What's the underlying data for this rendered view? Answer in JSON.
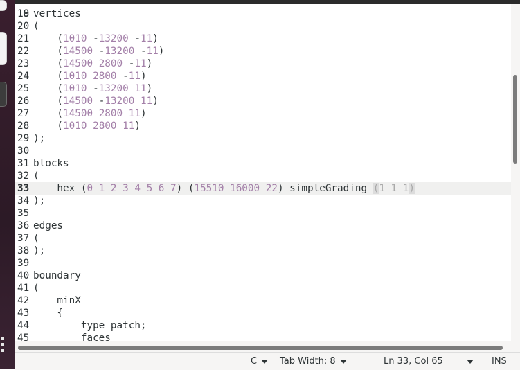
{
  "editor": {
    "current_line": 33,
    "partial_top_line": "18",
    "lines": [
      {
        "n": "19",
        "segs": [
          {
            "t": "vertices",
            "c": ""
          }
        ]
      },
      {
        "n": "20",
        "segs": [
          {
            "t": "(",
            "c": ""
          }
        ]
      },
      {
        "n": "21",
        "segs": [
          {
            "t": "    (",
            "c": ""
          },
          {
            "t": "1010",
            "c": "num"
          },
          {
            "t": " -",
            "c": ""
          },
          {
            "t": "13200",
            "c": "num"
          },
          {
            "t": " -",
            "c": ""
          },
          {
            "t": "11",
            "c": "num"
          },
          {
            "t": ")",
            "c": ""
          }
        ]
      },
      {
        "n": "22",
        "segs": [
          {
            "t": "    (",
            "c": ""
          },
          {
            "t": "14500",
            "c": "num"
          },
          {
            "t": " -",
            "c": ""
          },
          {
            "t": "13200",
            "c": "num"
          },
          {
            "t": " -",
            "c": ""
          },
          {
            "t": "11",
            "c": "num"
          },
          {
            "t": ")",
            "c": ""
          }
        ]
      },
      {
        "n": "23",
        "segs": [
          {
            "t": "    (",
            "c": ""
          },
          {
            "t": "14500",
            "c": "num"
          },
          {
            "t": " ",
            "c": ""
          },
          {
            "t": "2800",
            "c": "num"
          },
          {
            "t": " -",
            "c": ""
          },
          {
            "t": "11",
            "c": "num"
          },
          {
            "t": ")",
            "c": ""
          }
        ]
      },
      {
        "n": "24",
        "segs": [
          {
            "t": "    (",
            "c": ""
          },
          {
            "t": "1010",
            "c": "num"
          },
          {
            "t": " ",
            "c": ""
          },
          {
            "t": "2800",
            "c": "num"
          },
          {
            "t": " -",
            "c": ""
          },
          {
            "t": "11",
            "c": "num"
          },
          {
            "t": ")",
            "c": ""
          }
        ]
      },
      {
        "n": "25",
        "segs": [
          {
            "t": "    (",
            "c": ""
          },
          {
            "t": "1010",
            "c": "num"
          },
          {
            "t": " -",
            "c": ""
          },
          {
            "t": "13200",
            "c": "num"
          },
          {
            "t": " ",
            "c": ""
          },
          {
            "t": "11",
            "c": "num"
          },
          {
            "t": ")",
            "c": ""
          }
        ]
      },
      {
        "n": "26",
        "segs": [
          {
            "t": "    (",
            "c": ""
          },
          {
            "t": "14500",
            "c": "num"
          },
          {
            "t": " -",
            "c": ""
          },
          {
            "t": "13200",
            "c": "num"
          },
          {
            "t": " ",
            "c": ""
          },
          {
            "t": "11",
            "c": "num"
          },
          {
            "t": ")",
            "c": ""
          }
        ]
      },
      {
        "n": "27",
        "segs": [
          {
            "t": "    (",
            "c": ""
          },
          {
            "t": "14500",
            "c": "num"
          },
          {
            "t": " ",
            "c": ""
          },
          {
            "t": "2800",
            "c": "num"
          },
          {
            "t": " ",
            "c": ""
          },
          {
            "t": "11",
            "c": "num"
          },
          {
            "t": ")",
            "c": ""
          }
        ]
      },
      {
        "n": "28",
        "segs": [
          {
            "t": "    (",
            "c": ""
          },
          {
            "t": "1010",
            "c": "num"
          },
          {
            "t": " ",
            "c": ""
          },
          {
            "t": "2800",
            "c": "num"
          },
          {
            "t": " ",
            "c": ""
          },
          {
            "t": "11",
            "c": "num"
          },
          {
            "t": ")",
            "c": ""
          }
        ]
      },
      {
        "n": "29",
        "segs": [
          {
            "t": ");",
            "c": ""
          }
        ]
      },
      {
        "n": "30",
        "segs": []
      },
      {
        "n": "31",
        "segs": [
          {
            "t": "blocks",
            "c": ""
          }
        ]
      },
      {
        "n": "32",
        "segs": [
          {
            "t": "(",
            "c": ""
          }
        ]
      },
      {
        "n": "33",
        "segs": [
          {
            "t": "    hex (",
            "c": ""
          },
          {
            "t": "0",
            "c": "num"
          },
          {
            "t": " ",
            "c": ""
          },
          {
            "t": "1",
            "c": "num"
          },
          {
            "t": " ",
            "c": ""
          },
          {
            "t": "2",
            "c": "num"
          },
          {
            "t": " ",
            "c": ""
          },
          {
            "t": "3",
            "c": "num"
          },
          {
            "t": " ",
            "c": ""
          },
          {
            "t": "4",
            "c": "num"
          },
          {
            "t": " ",
            "c": ""
          },
          {
            "t": "5",
            "c": "num"
          },
          {
            "t": " ",
            "c": ""
          },
          {
            "t": "6",
            "c": "num"
          },
          {
            "t": " ",
            "c": ""
          },
          {
            "t": "7",
            "c": "num"
          },
          {
            "t": ") (",
            "c": ""
          },
          {
            "t": "15510",
            "c": "num"
          },
          {
            "t": " ",
            "c": ""
          },
          {
            "t": "16000",
            "c": "num"
          },
          {
            "t": " ",
            "c": ""
          },
          {
            "t": "22",
            "c": "num"
          },
          {
            "t": ") simpleGrading ",
            "c": ""
          },
          {
            "t": "(",
            "c": "hlp"
          },
          {
            "t": "1 1 1",
            "c": "dim"
          },
          {
            "t": ")",
            "c": "hlp"
          }
        ]
      },
      {
        "n": "34",
        "segs": [
          {
            "t": ");",
            "c": ""
          }
        ]
      },
      {
        "n": "35",
        "segs": []
      },
      {
        "n": "36",
        "segs": [
          {
            "t": "edges",
            "c": ""
          }
        ]
      },
      {
        "n": "37",
        "segs": [
          {
            "t": "(",
            "c": ""
          }
        ]
      },
      {
        "n": "38",
        "segs": [
          {
            "t": ");",
            "c": ""
          }
        ]
      },
      {
        "n": "39",
        "segs": []
      },
      {
        "n": "40",
        "segs": [
          {
            "t": "boundary",
            "c": ""
          }
        ]
      },
      {
        "n": "41",
        "segs": [
          {
            "t": "(",
            "c": ""
          }
        ]
      },
      {
        "n": "42",
        "segs": [
          {
            "t": "    minX",
            "c": ""
          }
        ]
      },
      {
        "n": "43",
        "segs": [
          {
            "t": "    {",
            "c": ""
          }
        ]
      },
      {
        "n": "44",
        "segs": [
          {
            "t": "        type patch;",
            "c": ""
          }
        ]
      },
      {
        "n": "45",
        "segs": [
          {
            "t": "        faces",
            "c": ""
          }
        ]
      }
    ]
  },
  "statusbar": {
    "language": "C",
    "tab_width": "Tab Width: 8",
    "position": "Ln 33, Col 65",
    "mode": "INS"
  }
}
